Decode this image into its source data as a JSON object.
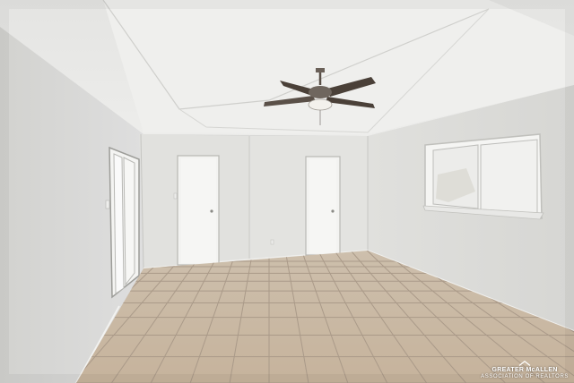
{
  "photo": {
    "subject": "empty-room-with-ceiling-fan",
    "colors": {
      "ceiling": "#e9e9e7",
      "walls": "#dcdcd9",
      "floor_tile": "#cbbba6",
      "grout": "#a9998a",
      "fan": "#4a4038",
      "window_light": "#ececea"
    }
  },
  "watermark": {
    "line1": "GREATER McALLEN",
    "line2": "ASSOCIATION OF REALTORS"
  }
}
